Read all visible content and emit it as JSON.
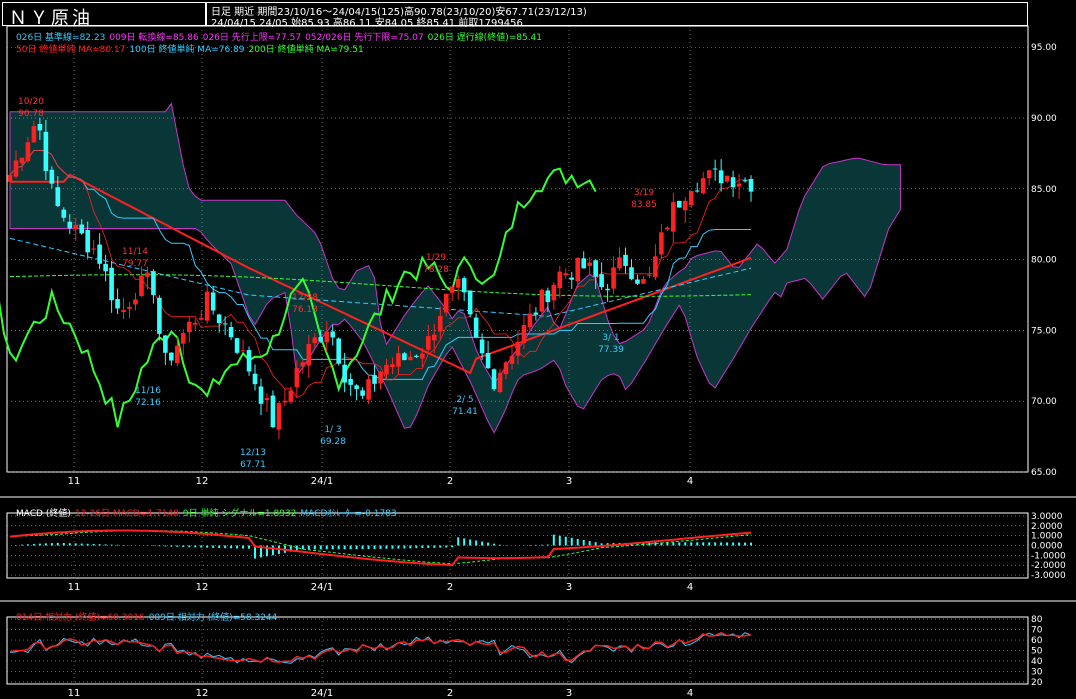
{
  "header": {
    "title": "ＮＹ原油",
    "line1": "日足  期近  期間23/10/16～24/04/15(125)高90.78(23/10/20)安67.71(23/12/13)",
    "line2": "24/04/15 24/05 始85.93 高86.11 安84.05 終85.41 前取1799456"
  },
  "legend": {
    "row1": [
      {
        "text": "026日 基準線=82.23",
        "color": "#33ccff"
      },
      {
        "text": "009日 転換線=85.86",
        "color": "#ff33ff"
      },
      {
        "text": "026日 先行上限=77.57",
        "color": "#ff33ff"
      },
      {
        "text": "052/026日 先行下限=75.07",
        "color": "#ff33ff"
      },
      {
        "text": "026日 遅行線(終値)=85.41",
        "color": "#33ff33"
      }
    ],
    "row2": [
      {
        "text": "50日 終値単純 MA=80.17",
        "color": "#ff2020"
      },
      {
        "text": "100日 終値単純 MA=76.89",
        "color": "#33ccff"
      },
      {
        "text": "200日 終値単純 MA=79.51",
        "color": "#33ff33"
      }
    ],
    "macd": [
      {
        "text": "MACD (終値)",
        "color": "#ffffff"
      },
      {
        "text": "12-26日 MACD=1.7148",
        "color": "#ff2020"
      },
      {
        "text": "9日 単純 シグナル=1.8932",
        "color": "#33ff33"
      },
      {
        "text": "MACDｵｼﾚｰﾀｰ=-0.1783",
        "color": "#33ccff"
      }
    ],
    "rsi": [
      {
        "text": "014日 相対力 (終値)=60.3016",
        "color": "#ff2020"
      },
      {
        "text": "009日 相対力 (終値)=58.3244",
        "color": "#33ccff"
      }
    ]
  },
  "colors": {
    "up": "#ff2020",
    "down": "#33ffff",
    "grid": "#aaaaaa",
    "border": "#ffffff",
    "kijun": "#33ccff",
    "tenkan": "#ff2020",
    "chikou": "#33ff33",
    "cloud": "#cc33cc",
    "cloud_fill": "#22dddd",
    "ma50": "#ff2020",
    "ma100": "#33ccff",
    "ma200": "#33ff33",
    "hi_label": "#ff3030",
    "lo_label": "#33ccff"
  },
  "chart_data": [
    {
      "type": "candlestick",
      "y_ticks": [
        "95.00",
        "90.00",
        "85.00",
        "80.00",
        "75.00",
        "70.00",
        "65.00"
      ],
      "ylim": [
        65,
        96.5
      ],
      "x_labels": [
        "11",
        "12",
        "24/1",
        "2",
        "3",
        "4"
      ],
      "annotations": [
        {
          "kind": "high",
          "date": "10/20",
          "value": "90.78"
        },
        {
          "kind": "high",
          "date": "11/14",
          "value": "79.77"
        },
        {
          "kind": "low",
          "date": "11/16",
          "value": "72.16"
        },
        {
          "kind": "low",
          "date": "12/13",
          "value": "67.71"
        },
        {
          "kind": "high",
          "date": "12/28",
          "value": "76.18"
        },
        {
          "kind": "low",
          "date": "1/ 3",
          "value": "69.28"
        },
        {
          "kind": "high",
          "date": "1/29",
          "value": "78.28"
        },
        {
          "kind": "low",
          "date": "2/ 5",
          "value": "71.41"
        },
        {
          "kind": "high",
          "date": "3/19",
          "value": "83.85"
        },
        {
          "kind": "low",
          "date": "3/ 1",
          "value": "77.39"
        }
      ]
    },
    {
      "type": "line",
      "y_ticks": [
        "3.0000",
        "2.0000",
        "1.0000",
        "0.0000",
        "-1.0000",
        "-2.0000",
        "-3.0000"
      ],
      "ylim": [
        -3.3,
        3.3
      ],
      "x_labels": [
        "11",
        "12",
        "24/1",
        "2",
        "3",
        "4"
      ]
    },
    {
      "type": "line",
      "y_ticks": [
        "80",
        "70",
        "60",
        "50",
        "40",
        "30",
        "20"
      ],
      "ylim": [
        18,
        82
      ],
      "x_labels": [
        "11",
        "12",
        "24/1",
        "2",
        "3",
        "4"
      ]
    }
  ]
}
